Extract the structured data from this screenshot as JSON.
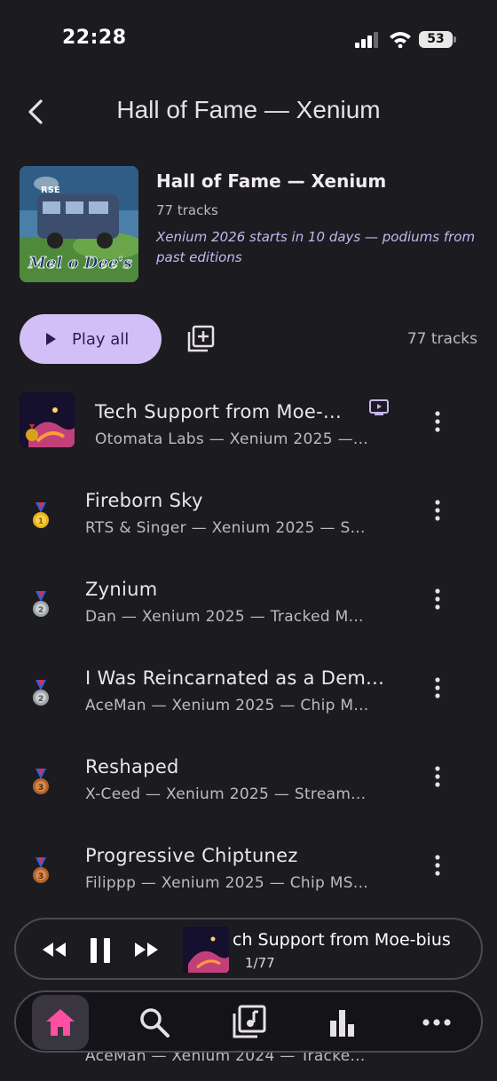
{
  "status": {
    "time": "22:28",
    "battery": "53"
  },
  "header": {
    "title": "Hall of Fame — Xenium"
  },
  "playlist": {
    "title": "Hall of Fame — Xenium",
    "count": "77 tracks",
    "description": "Xenium 2026 starts in 10 days — podiums from past editions"
  },
  "actions": {
    "play_all": "Play all",
    "count": "77 tracks"
  },
  "tracks": [
    {
      "title": "Tech Support from Moe-...",
      "subtitle": "Otomata Labs — Xenium 2025 —...",
      "medal": "gold"
    },
    {
      "title": "Fireborn Sky",
      "subtitle": "RTS & Singer — Xenium 2025 — S...",
      "medal": "gold"
    },
    {
      "title": "Zynium",
      "subtitle": "Dan — Xenium 2025 — Tracked M...",
      "medal": "silver"
    },
    {
      "title": "I Was Reincarnated as a Dem...",
      "subtitle": "AceMan — Xenium 2025 — Chip M...",
      "medal": "silver"
    },
    {
      "title": "Reshaped",
      "subtitle": "X-Ceed — Xenium 2025 — Stream...",
      "medal": "bronze"
    },
    {
      "title": "Progressive Chiptunez",
      "subtitle": "Filippp — Xenium 2025 — Chip MS...",
      "medal": "bronze"
    },
    {
      "title": "",
      "subtitle": "AceMan — Xenium 2024 — Tracke...",
      "medal": "gold"
    }
  ],
  "mini_player": {
    "title": "ch Support from Moe-bius",
    "position": "1/77"
  },
  "nav": [
    "home-icon",
    "search-icon",
    "library-icon",
    "stats-icon",
    "more-icon"
  ],
  "colors": {
    "accent": "#d3bff7",
    "nav_active": "#ff4fa3",
    "background": "#1c1b1f"
  }
}
